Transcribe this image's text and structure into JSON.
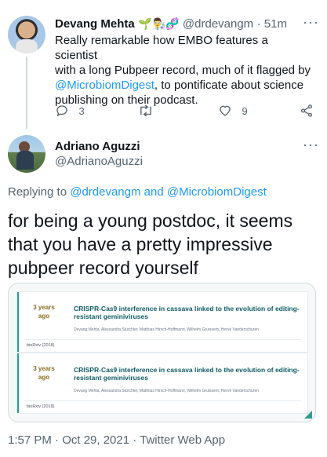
{
  "parent_tweet": {
    "name": "Devang Mehta",
    "emojis": "🌱👨‍🔬🧬",
    "handle": "@drdevangm",
    "time": "· 51m",
    "text_lines": [
      "Really remarkable how EMBO features a scientist",
      "with a long Pubpeer record, much of it flagged by",
      "to pontificate about science",
      "publishing on their podcast."
    ],
    "mention": "@MicrobiomDigest",
    "replies": "3",
    "likes": "9"
  },
  "main_tweet": {
    "name": "Adriano Aguzzi",
    "handle": "@AdrianoAguzzi",
    "replying_to_label": "Replying to",
    "replying_to_users": "@drdevangm and @MicrobiomDigest",
    "text_lines": [
      "for being a young postdoc, it seems",
      "that you have a pretty impressive",
      "pubpeer record yourself"
    ],
    "timestamp": "1:57 PM · Oct 29, 2021 · Twitter Web App"
  },
  "card": {
    "entries": [
      {
        "age_line1": "3 years",
        "age_line2": "ago",
        "title": "CRISPR-Cas9 interference in cassava linked to the evolution of editing-resistant geminiviruses",
        "authors": "Devang Mehta, Alessandra Stürchler, Matthias Hirsch-Hoffmann, Wilhelm Gruissem, Hervé Vanderschuren",
        "source": "bioRxiv (2018)"
      },
      {
        "age_line1": "3 years",
        "age_line2": "ago",
        "title": "CRISPR-Cas9 interference in cassava linked to the evolution of editing-resistant geminiviruses",
        "authors": "Devang Mehta, Alessandra Stürchler, Matthias Hirsch-Hoffmann, Wilhelm Gruissem, Hervé Vanderschuren",
        "source": "bioRxiv (2018)"
      }
    ]
  },
  "icons": {
    "more": "more-horizontal-icon",
    "reply": "reply-icon",
    "retweet": "retweet-icon",
    "like": "like-icon",
    "share": "share-icon"
  },
  "colors": {
    "link": "#1d9bf0",
    "secondary_text": "#536471",
    "card_title": "#0d5c63",
    "card_age": "#8a6d1f"
  }
}
